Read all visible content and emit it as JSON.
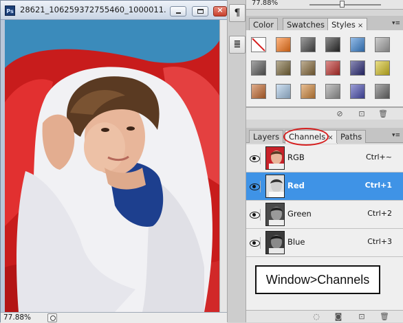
{
  "document": {
    "title": "28621_106259372755460_1000011...",
    "zoom": "77.88%"
  },
  "navigator": {
    "zoom": "77.88%"
  },
  "side_tools": [
    {
      "icon": "paragraph-icon",
      "glyph": "¶"
    },
    {
      "icon": "notes-icon",
      "glyph": "≣"
    }
  ],
  "styles_panel": {
    "tabs": [
      {
        "label": "Color"
      },
      {
        "label": "Swatches"
      },
      {
        "label": "Styles",
        "active": true,
        "close": "×"
      }
    ],
    "swatch_colors": [
      "#ffffff",
      "#ff7a1a",
      "#4a4a4a",
      "#2b2b2b",
      "#3c86d6",
      "#a7a7a7",
      "#5c5c5c",
      "#7d6a3b",
      "#8a6d3c",
      "#c2302c",
      "#2b2b7a",
      "#d8c423",
      "#c86b2e",
      "#a9c9e8",
      "#d58a3c",
      "#9a9a9a",
      "#4b4fb5",
      "#6b6b6b"
    ],
    "footer_icons": [
      "no-style-icon",
      "new-style-icon",
      "trash-icon"
    ]
  },
  "channels_panel": {
    "tabs": [
      {
        "label": "Layers"
      },
      {
        "label": "Channels",
        "active": true,
        "close": "×"
      },
      {
        "label": "Paths"
      }
    ],
    "channels": [
      {
        "name": "RGB",
        "shortcut": "Ctrl+~",
        "selected": false
      },
      {
        "name": "Red",
        "shortcut": "Ctrl+1",
        "selected": true
      },
      {
        "name": "Green",
        "shortcut": "Ctrl+2",
        "selected": false
      },
      {
        "name": "Blue",
        "shortcut": "Ctrl+3",
        "selected": false
      }
    ],
    "footer_icons": [
      "load-selection-icon",
      "save-selection-icon",
      "new-channel-icon",
      "trash-icon"
    ]
  },
  "annotation": {
    "text": "Window>Channels"
  },
  "colors": {
    "selection": "#3f93e6",
    "highlight_ring": "#d61f1f"
  }
}
